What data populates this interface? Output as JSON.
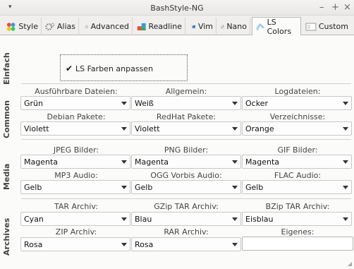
{
  "window": {
    "title": "BashStyle-NG",
    "menu_glyph": "▾",
    "minimize": "–",
    "maximize": "+",
    "close": "×"
  },
  "tabs": [
    {
      "label": "Style",
      "icon": "palette-icon"
    },
    {
      "label": "Alias",
      "icon": "gears-icon"
    },
    {
      "label": "Advanced",
      "icon": "gear-icon"
    },
    {
      "label": "Readline",
      "icon": "blocks-icon"
    },
    {
      "label": "Vim",
      "icon": "gnu-icon"
    },
    {
      "label": "Nano",
      "icon": "pen-icon"
    },
    {
      "label": "LS Colors",
      "icon": "color-swatch-icon",
      "active": true
    },
    {
      "label": "Custom",
      "icon": "document-icon"
    }
  ],
  "sections": {
    "einfach": "Einfach",
    "common": "Common",
    "media": "Media",
    "archives": "Archives"
  },
  "checkbox": {
    "label": "LS Farben anpassen",
    "checked": true,
    "mark": "✔"
  },
  "fields": {
    "exe": {
      "label": "Ausführbare Dateien:",
      "value": "Grün"
    },
    "general": {
      "label": "Allgemein:",
      "value": "Weiß"
    },
    "log": {
      "label": "Logdateien:",
      "value": "Ocker"
    },
    "deb": {
      "label": "Debian Pakete:",
      "value": "Violett"
    },
    "rpm": {
      "label": "RedHat Pakete:",
      "value": "Violett"
    },
    "dirs": {
      "label": "Verzeichnisse:",
      "value": "Orange"
    },
    "jpeg": {
      "label": "JPEG Bilder:",
      "value": "Magenta"
    },
    "png": {
      "label": "PNG Bilder:",
      "value": "Magenta"
    },
    "gif": {
      "label": "GIF Bilder:",
      "value": "Magenta"
    },
    "mp3": {
      "label": "MP3 Audio:",
      "value": "Gelb"
    },
    "ogg": {
      "label": "OGG Vorbis Audio:",
      "value": "Gelb"
    },
    "flac": {
      "label": "FLAC Audio:",
      "value": "Gelb"
    },
    "tar": {
      "label": "TAR Archiv:",
      "value": "Cyan"
    },
    "gzip": {
      "label": "GZip TAR Archiv:",
      "value": "Blau"
    },
    "bzip": {
      "label": "BZip TAR Archiv:",
      "value": "Eisblau"
    },
    "zip": {
      "label": "ZIP Archiv:",
      "value": "Rosa"
    },
    "rar": {
      "label": "RAR Archiv:",
      "value": "Rosa"
    },
    "own": {
      "label": "Eigenes:",
      "value": ""
    }
  },
  "colors": {
    "accent": "#4a90d9",
    "window_bg": "#f0efed",
    "panel_bg": "#fbfbfa"
  }
}
